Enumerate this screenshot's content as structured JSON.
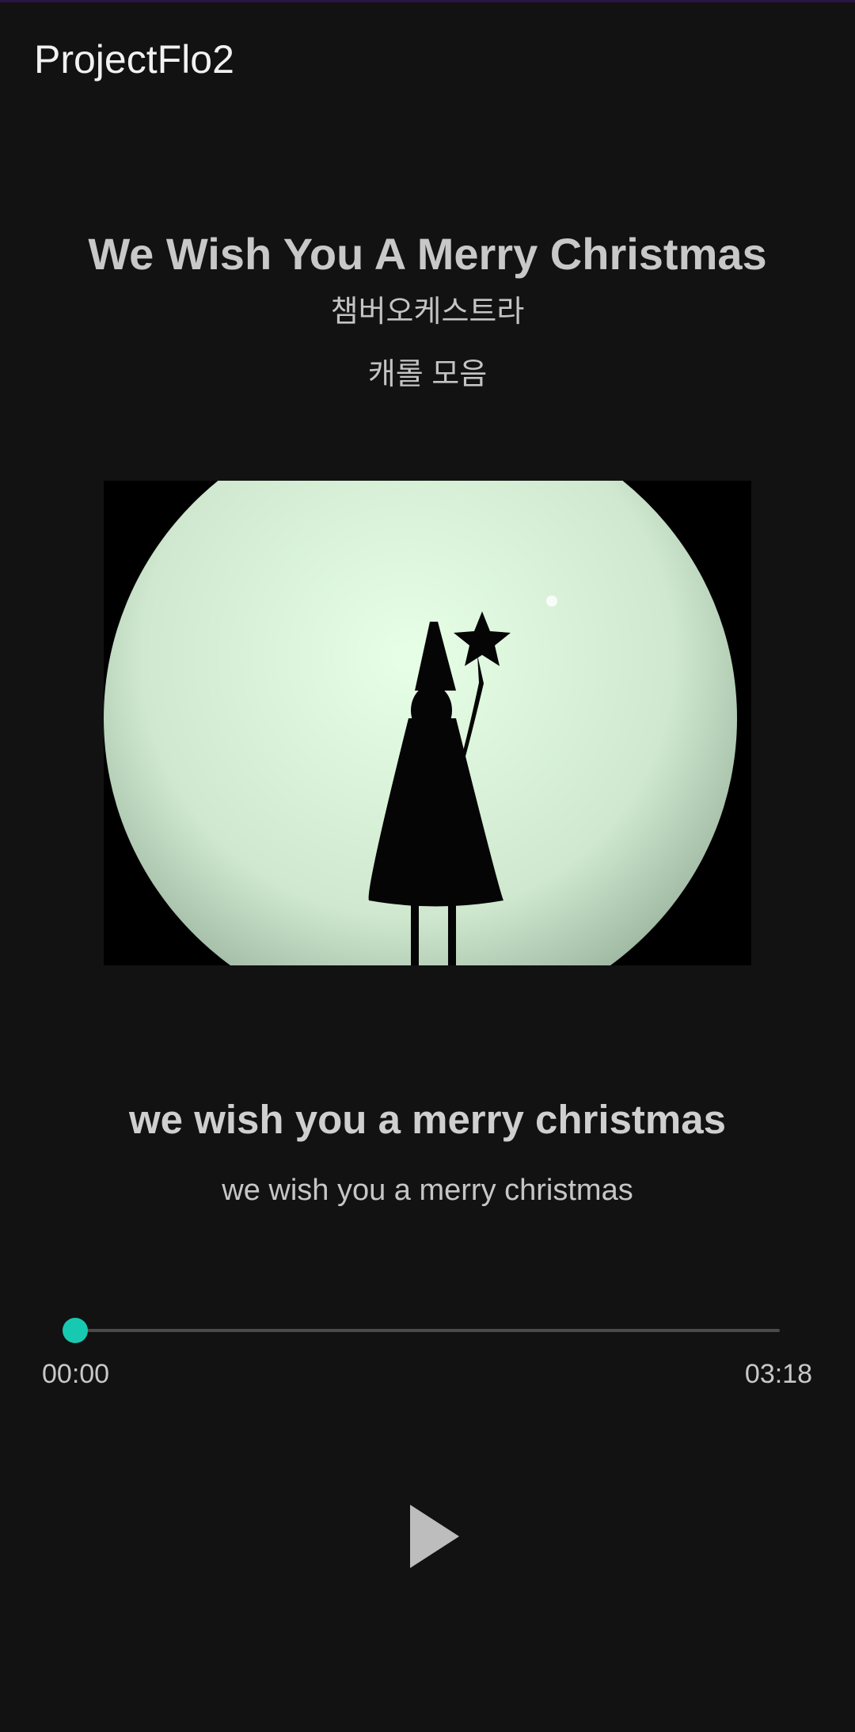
{
  "app": {
    "title": "ProjectFlo2"
  },
  "song": {
    "title": "We Wish You A Merry Christmas",
    "artist": "챔버오케스트라",
    "album": "캐롤 모음"
  },
  "album_art": {
    "description_icon": "album-cover-image"
  },
  "lyrics": {
    "current": "we wish you a merry christmas",
    "next": "we wish you a merry christmas"
  },
  "player": {
    "elapsed": "00:00",
    "duration": "03:18",
    "progress": 0.0,
    "play_icon": "play-icon",
    "accent_color": "#18c9b1"
  }
}
